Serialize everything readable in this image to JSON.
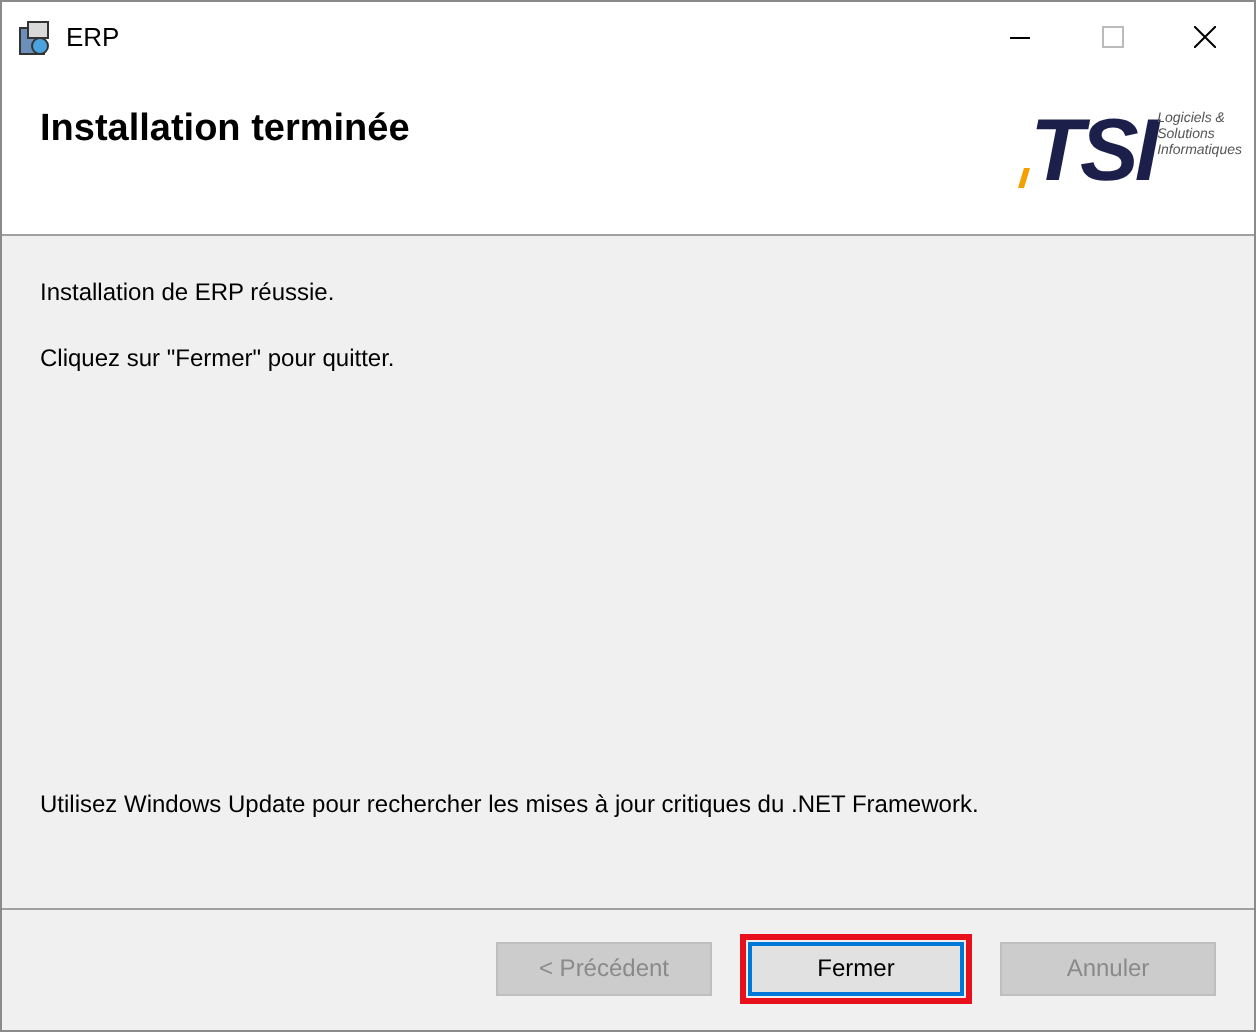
{
  "window": {
    "title": "ERP"
  },
  "header": {
    "title": "Installation terminée",
    "logo": {
      "mark": "TSI",
      "tagline": [
        "Logiciels &",
        "Solutions",
        "Informatiques"
      ]
    }
  },
  "body": {
    "messages": [
      "Installation de ERP réussie.",
      "Cliquez sur \"Fermer\" pour quitter."
    ],
    "note": "Utilisez Windows Update pour rechercher les mises à jour critiques du .NET Framework."
  },
  "buttons": [
    {
      "label": "< Précédent",
      "disabled": true,
      "highlighted": false,
      "focused": false
    },
    {
      "label": "Fermer",
      "disabled": false,
      "highlighted": true,
      "focused": true
    },
    {
      "label": "Annuler",
      "disabled": true,
      "highlighted": false,
      "focused": false
    }
  ]
}
